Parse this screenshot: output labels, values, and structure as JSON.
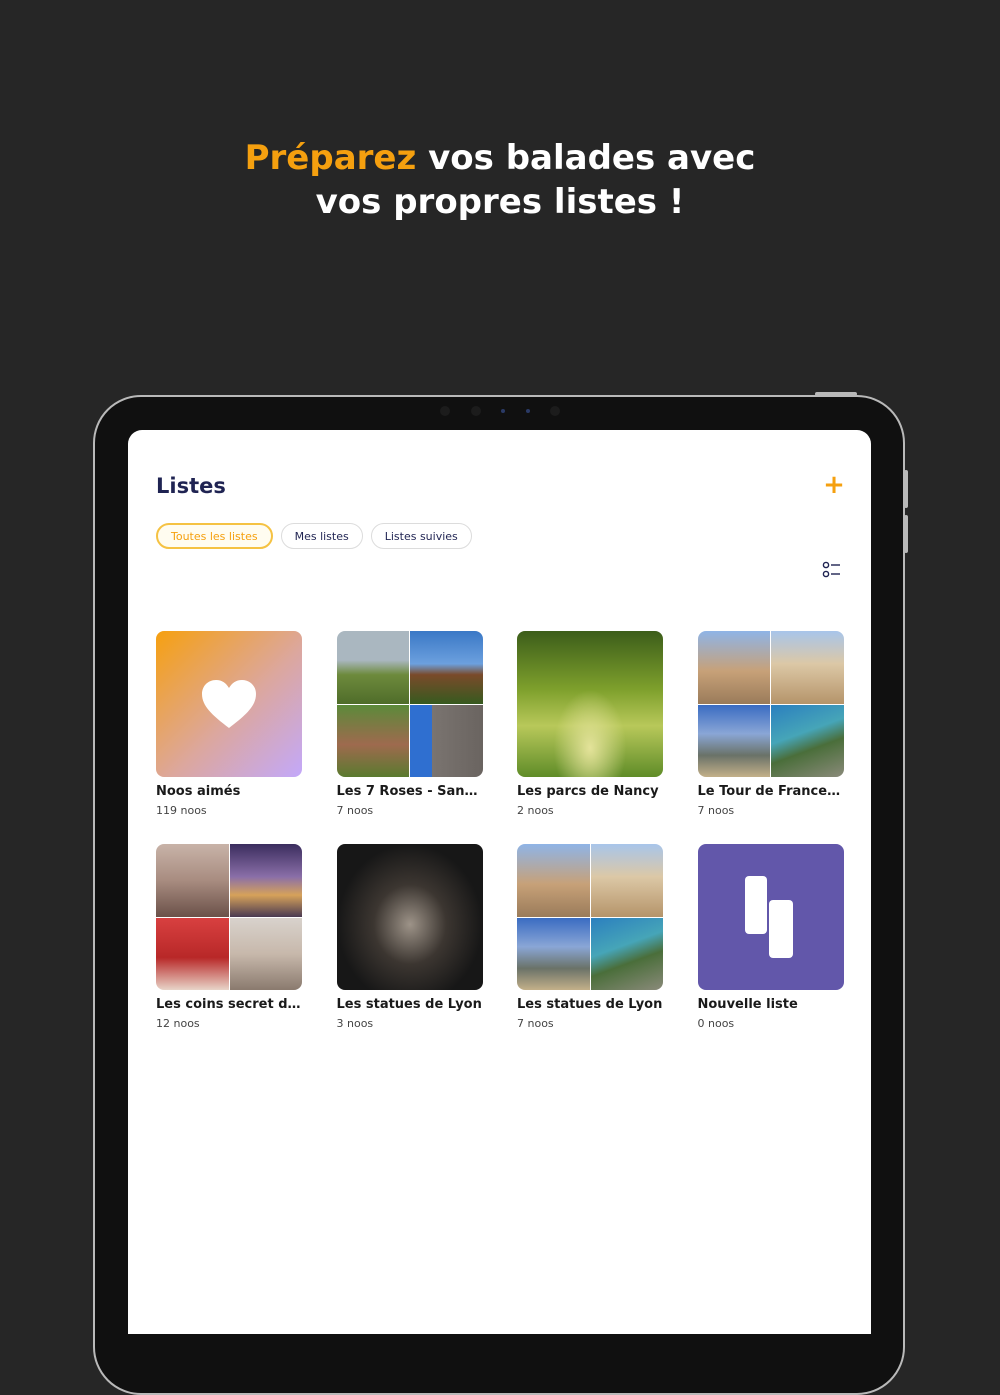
{
  "headline": {
    "accent": "Préparez",
    "rest": " vos balades avec",
    "line2": "vos propres listes !"
  },
  "screen": {
    "title": "Listes",
    "add_label": "+",
    "tabs": [
      {
        "label": "Toutes les listes",
        "active": true
      },
      {
        "label": "Mes listes",
        "active": false
      },
      {
        "label": "Listes suivies",
        "active": false
      }
    ]
  },
  "lists": [
    {
      "title": "Noos aimés",
      "count": "119 noos",
      "thumb": "heart-gradient"
    },
    {
      "title": "Les 7 Roses - Sanct...",
      "count": "7 noos",
      "thumb": "mosaic-churches"
    },
    {
      "title": "Les parcs de Nancy",
      "count": "2 noos",
      "thumb": "park-trees"
    },
    {
      "title": "Le Tour de France ...",
      "count": "7 noos",
      "thumb": "mosaic-monuments"
    },
    {
      "title": "Les coins secret de...",
      "count": "12 noos",
      "thumb": "mosaic-paris"
    },
    {
      "title": "Les statues de Lyon",
      "count": "3 noos",
      "thumb": "statue-dark"
    },
    {
      "title": "Les statues de Lyon",
      "count": "7 noos",
      "thumb": "mosaic-monuments"
    },
    {
      "title": "Nouvelle liste",
      "count": "0 noos",
      "thumb": "brand-logo"
    }
  ],
  "colors": {
    "accent": "#f5a00f",
    "title_navy": "#1f2352",
    "brand_purple": "#6257aa",
    "background": "#262626"
  },
  "icons": {
    "add": "plus-icon",
    "sort": "sort-list-icon",
    "liked": "heart-icon",
    "brand": "noos-logo-icon"
  }
}
